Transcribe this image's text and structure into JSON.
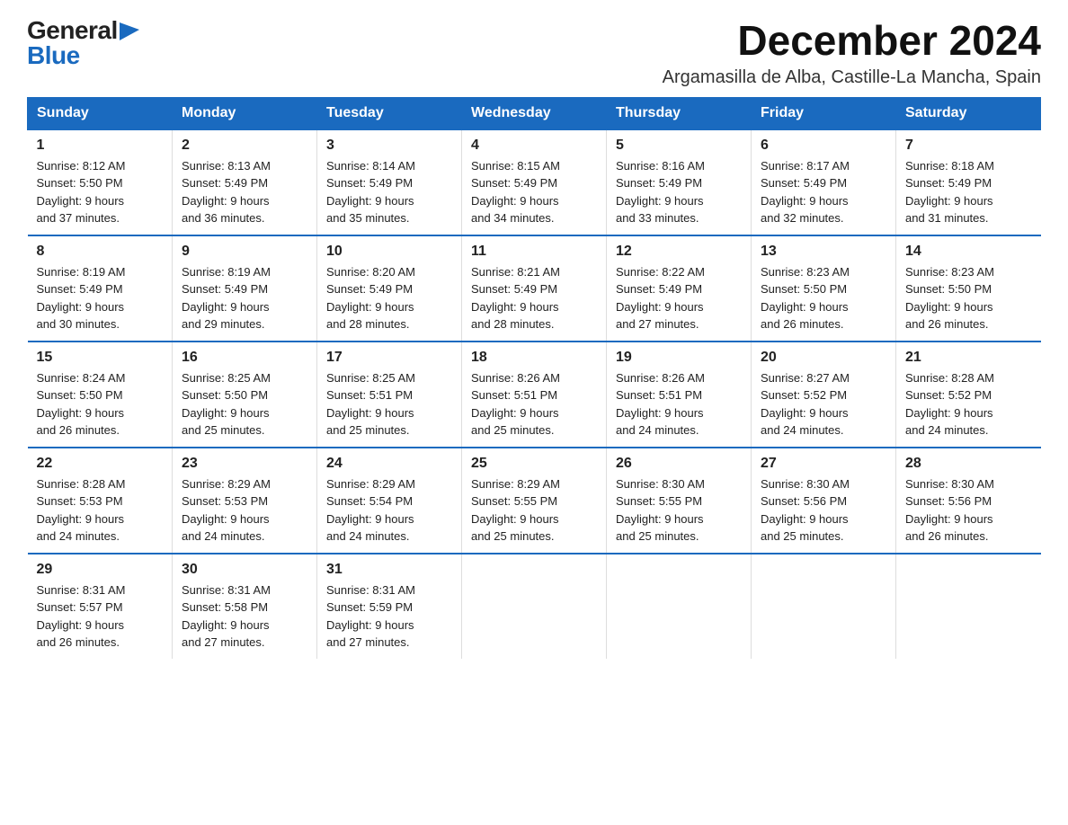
{
  "logo": {
    "general": "General",
    "blue": "Blue",
    "triangle": "▶"
  },
  "header": {
    "month_year": "December 2024",
    "location": "Argamasilla de Alba, Castille-La Mancha, Spain"
  },
  "weekdays": [
    "Sunday",
    "Monday",
    "Tuesday",
    "Wednesday",
    "Thursday",
    "Friday",
    "Saturday"
  ],
  "weeks": [
    [
      {
        "day": "1",
        "sunrise": "8:12 AM",
        "sunset": "5:50 PM",
        "daylight": "9 hours and 37 minutes."
      },
      {
        "day": "2",
        "sunrise": "8:13 AM",
        "sunset": "5:49 PM",
        "daylight": "9 hours and 36 minutes."
      },
      {
        "day": "3",
        "sunrise": "8:14 AM",
        "sunset": "5:49 PM",
        "daylight": "9 hours and 35 minutes."
      },
      {
        "day": "4",
        "sunrise": "8:15 AM",
        "sunset": "5:49 PM",
        "daylight": "9 hours and 34 minutes."
      },
      {
        "day": "5",
        "sunrise": "8:16 AM",
        "sunset": "5:49 PM",
        "daylight": "9 hours and 33 minutes."
      },
      {
        "day": "6",
        "sunrise": "8:17 AM",
        "sunset": "5:49 PM",
        "daylight": "9 hours and 32 minutes."
      },
      {
        "day": "7",
        "sunrise": "8:18 AM",
        "sunset": "5:49 PM",
        "daylight": "9 hours and 31 minutes."
      }
    ],
    [
      {
        "day": "8",
        "sunrise": "8:19 AM",
        "sunset": "5:49 PM",
        "daylight": "9 hours and 30 minutes."
      },
      {
        "day": "9",
        "sunrise": "8:19 AM",
        "sunset": "5:49 PM",
        "daylight": "9 hours and 29 minutes."
      },
      {
        "day": "10",
        "sunrise": "8:20 AM",
        "sunset": "5:49 PM",
        "daylight": "9 hours and 28 minutes."
      },
      {
        "day": "11",
        "sunrise": "8:21 AM",
        "sunset": "5:49 PM",
        "daylight": "9 hours and 28 minutes."
      },
      {
        "day": "12",
        "sunrise": "8:22 AM",
        "sunset": "5:49 PM",
        "daylight": "9 hours and 27 minutes."
      },
      {
        "day": "13",
        "sunrise": "8:23 AM",
        "sunset": "5:50 PM",
        "daylight": "9 hours and 26 minutes."
      },
      {
        "day": "14",
        "sunrise": "8:23 AM",
        "sunset": "5:50 PM",
        "daylight": "9 hours and 26 minutes."
      }
    ],
    [
      {
        "day": "15",
        "sunrise": "8:24 AM",
        "sunset": "5:50 PM",
        "daylight": "9 hours and 26 minutes."
      },
      {
        "day": "16",
        "sunrise": "8:25 AM",
        "sunset": "5:50 PM",
        "daylight": "9 hours and 25 minutes."
      },
      {
        "day": "17",
        "sunrise": "8:25 AM",
        "sunset": "5:51 PM",
        "daylight": "9 hours and 25 minutes."
      },
      {
        "day": "18",
        "sunrise": "8:26 AM",
        "sunset": "5:51 PM",
        "daylight": "9 hours and 25 minutes."
      },
      {
        "day": "19",
        "sunrise": "8:26 AM",
        "sunset": "5:51 PM",
        "daylight": "9 hours and 24 minutes."
      },
      {
        "day": "20",
        "sunrise": "8:27 AM",
        "sunset": "5:52 PM",
        "daylight": "9 hours and 24 minutes."
      },
      {
        "day": "21",
        "sunrise": "8:28 AM",
        "sunset": "5:52 PM",
        "daylight": "9 hours and 24 minutes."
      }
    ],
    [
      {
        "day": "22",
        "sunrise": "8:28 AM",
        "sunset": "5:53 PM",
        "daylight": "9 hours and 24 minutes."
      },
      {
        "day": "23",
        "sunrise": "8:29 AM",
        "sunset": "5:53 PM",
        "daylight": "9 hours and 24 minutes."
      },
      {
        "day": "24",
        "sunrise": "8:29 AM",
        "sunset": "5:54 PM",
        "daylight": "9 hours and 24 minutes."
      },
      {
        "day": "25",
        "sunrise": "8:29 AM",
        "sunset": "5:55 PM",
        "daylight": "9 hours and 25 minutes."
      },
      {
        "day": "26",
        "sunrise": "8:30 AM",
        "sunset": "5:55 PM",
        "daylight": "9 hours and 25 minutes."
      },
      {
        "day": "27",
        "sunrise": "8:30 AM",
        "sunset": "5:56 PM",
        "daylight": "9 hours and 25 minutes."
      },
      {
        "day": "28",
        "sunrise": "8:30 AM",
        "sunset": "5:56 PM",
        "daylight": "9 hours and 26 minutes."
      }
    ],
    [
      {
        "day": "29",
        "sunrise": "8:31 AM",
        "sunset": "5:57 PM",
        "daylight": "9 hours and 26 minutes."
      },
      {
        "day": "30",
        "sunrise": "8:31 AM",
        "sunset": "5:58 PM",
        "daylight": "9 hours and 27 minutes."
      },
      {
        "day": "31",
        "sunrise": "8:31 AM",
        "sunset": "5:59 PM",
        "daylight": "9 hours and 27 minutes."
      },
      null,
      null,
      null,
      null
    ]
  ],
  "labels": {
    "sunrise": "Sunrise:",
    "sunset": "Sunset:",
    "daylight": "Daylight:"
  }
}
